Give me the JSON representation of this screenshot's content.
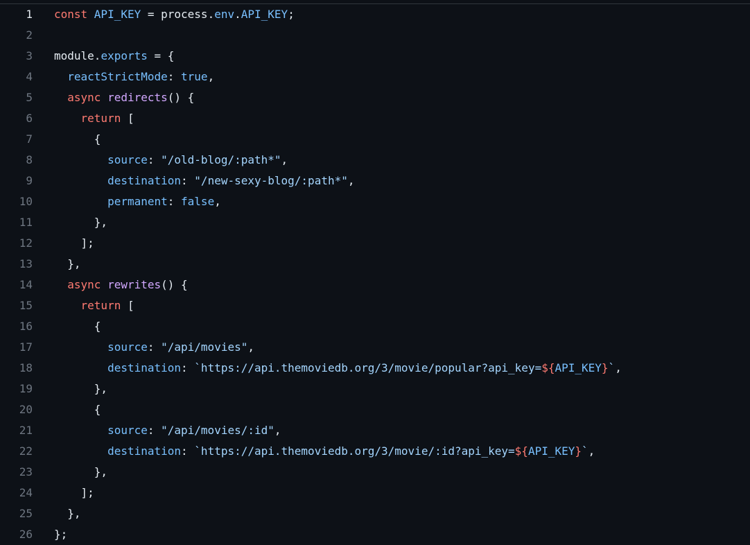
{
  "colors": {
    "background": "#0d1117",
    "line_number": "#6e7681",
    "line_number_active": "#e6edf3",
    "keyword": "#ff7b72",
    "variable": "#79c0ff",
    "function": "#d2a8ff",
    "string": "#a5d6ff",
    "text": "#e6edf3"
  },
  "editor": {
    "active_line": 1,
    "lines": [
      {
        "number": "1",
        "tokens": [
          [
            "kw",
            "const "
          ],
          [
            "var",
            "API_KEY"
          ],
          [
            "plain",
            " = process."
          ],
          [
            "var",
            "env"
          ],
          [
            "plain",
            "."
          ],
          [
            "var",
            "API_KEY"
          ],
          [
            "plain",
            ";"
          ]
        ]
      },
      {
        "number": "2",
        "tokens": []
      },
      {
        "number": "3",
        "tokens": [
          [
            "plain",
            "module."
          ],
          [
            "var",
            "exports"
          ],
          [
            "plain",
            " = {"
          ]
        ]
      },
      {
        "number": "4",
        "tokens": [
          [
            "plain",
            "  "
          ],
          [
            "var",
            "reactStrictMode"
          ],
          [
            "plain",
            ": "
          ],
          [
            "var",
            "true"
          ],
          [
            "plain",
            ","
          ]
        ]
      },
      {
        "number": "5",
        "tokens": [
          [
            "plain",
            "  "
          ],
          [
            "kw",
            "async "
          ],
          [
            "fn",
            "redirects"
          ],
          [
            "plain",
            "() {"
          ]
        ]
      },
      {
        "number": "6",
        "tokens": [
          [
            "plain",
            "    "
          ],
          [
            "kw",
            "return"
          ],
          [
            "plain",
            " ["
          ]
        ]
      },
      {
        "number": "7",
        "tokens": [
          [
            "plain",
            "      {"
          ]
        ]
      },
      {
        "number": "8",
        "tokens": [
          [
            "plain",
            "        "
          ],
          [
            "var",
            "source"
          ],
          [
            "plain",
            ": "
          ],
          [
            "str",
            "\"/old-blog/:path*\""
          ],
          [
            "plain",
            ","
          ]
        ]
      },
      {
        "number": "9",
        "tokens": [
          [
            "plain",
            "        "
          ],
          [
            "var",
            "destination"
          ],
          [
            "plain",
            ": "
          ],
          [
            "str",
            "\"/new-sexy-blog/:path*\""
          ],
          [
            "plain",
            ","
          ]
        ]
      },
      {
        "number": "10",
        "tokens": [
          [
            "plain",
            "        "
          ],
          [
            "var",
            "permanent"
          ],
          [
            "plain",
            ": "
          ],
          [
            "var",
            "false"
          ],
          [
            "plain",
            ","
          ]
        ]
      },
      {
        "number": "11",
        "tokens": [
          [
            "plain",
            "      },"
          ]
        ]
      },
      {
        "number": "12",
        "tokens": [
          [
            "plain",
            "    ];"
          ]
        ]
      },
      {
        "number": "13",
        "tokens": [
          [
            "plain",
            "  },"
          ]
        ]
      },
      {
        "number": "14",
        "tokens": [
          [
            "plain",
            "  "
          ],
          [
            "kw",
            "async "
          ],
          [
            "fn",
            "rewrites"
          ],
          [
            "plain",
            "() {"
          ]
        ]
      },
      {
        "number": "15",
        "tokens": [
          [
            "plain",
            "    "
          ],
          [
            "kw",
            "return"
          ],
          [
            "plain",
            " ["
          ]
        ]
      },
      {
        "number": "16",
        "tokens": [
          [
            "plain",
            "      {"
          ]
        ]
      },
      {
        "number": "17",
        "tokens": [
          [
            "plain",
            "        "
          ],
          [
            "var",
            "source"
          ],
          [
            "plain",
            ": "
          ],
          [
            "str",
            "\"/api/movies\""
          ],
          [
            "plain",
            ","
          ]
        ]
      },
      {
        "number": "18",
        "tokens": [
          [
            "plain",
            "        "
          ],
          [
            "var",
            "destination"
          ],
          [
            "plain",
            ": "
          ],
          [
            "str",
            "`https://api.themoviedb.org/3/movie/popular?api_key="
          ],
          [
            "kw",
            "${"
          ],
          [
            "var",
            "API_KEY"
          ],
          [
            "kw",
            "}"
          ],
          [
            "str",
            "`"
          ],
          [
            "plain",
            ","
          ]
        ]
      },
      {
        "number": "19",
        "tokens": [
          [
            "plain",
            "      },"
          ]
        ]
      },
      {
        "number": "20",
        "tokens": [
          [
            "plain",
            "      {"
          ]
        ]
      },
      {
        "number": "21",
        "tokens": [
          [
            "plain",
            "        "
          ],
          [
            "var",
            "source"
          ],
          [
            "plain",
            ": "
          ],
          [
            "str",
            "\"/api/movies/:id\""
          ],
          [
            "plain",
            ","
          ]
        ]
      },
      {
        "number": "22",
        "tokens": [
          [
            "plain",
            "        "
          ],
          [
            "var",
            "destination"
          ],
          [
            "plain",
            ": "
          ],
          [
            "str",
            "`https://api.themoviedb.org/3/movie/:id?api_key="
          ],
          [
            "kw",
            "${"
          ],
          [
            "var",
            "API_KEY"
          ],
          [
            "kw",
            "}"
          ],
          [
            "str",
            "`"
          ],
          [
            "plain",
            ","
          ]
        ]
      },
      {
        "number": "23",
        "tokens": [
          [
            "plain",
            "      },"
          ]
        ]
      },
      {
        "number": "24",
        "tokens": [
          [
            "plain",
            "    ];"
          ]
        ]
      },
      {
        "number": "25",
        "tokens": [
          [
            "plain",
            "  },"
          ]
        ]
      },
      {
        "number": "26",
        "tokens": [
          [
            "plain",
            "};"
          ]
        ]
      }
    ]
  }
}
